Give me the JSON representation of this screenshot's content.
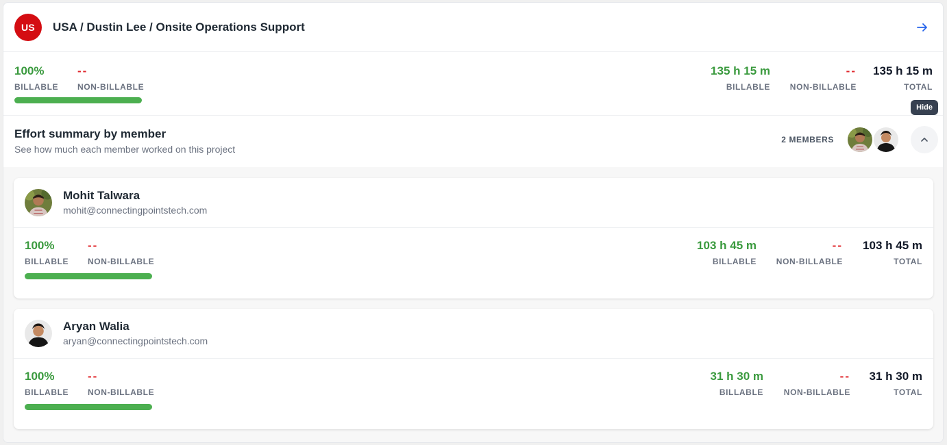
{
  "header": {
    "badge": "US",
    "title": "USA / Dustin Lee / Onsite Operations Support",
    "arrow_icon": "arrow-right-icon"
  },
  "project_stats": {
    "percent": "100%",
    "percent_label": "BILLABLE",
    "non_billable_dash": "--",
    "non_billable_label": "NON-BILLABLE",
    "billable_time": "135 h 15 m",
    "billable_time_label": "BILLABLE",
    "non_billable_time": "--",
    "non_billable_time_label": "NON-BILLABLE",
    "total_time": "135 h 15 m",
    "total_label": "TOTAL",
    "billable_fraction": 1.0
  },
  "summary": {
    "title": "Effort summary by member",
    "subtitle": "See how much each member worked on this project",
    "members_count": "2 MEMBERS",
    "tooltip": "Hide",
    "toggle_icon": "chevron-up-icon"
  },
  "members": [
    {
      "name": "Mohit Talwara",
      "email": "mohit@connectingpointstech.com",
      "percent": "100%",
      "percent_label": "BILLABLE",
      "non_billable_dash": "--",
      "non_billable_label": "NON-BILLABLE",
      "billable_time": "103 h 45 m",
      "billable_time_label": "BILLABLE",
      "non_billable_time": "--",
      "non_billable_time_label": "NON-BILLABLE",
      "total_time": "103 h 45 m",
      "total_label": "TOTAL",
      "billable_fraction": 1.0
    },
    {
      "name": "Aryan Walia",
      "email": "aryan@connectingpointstech.com",
      "percent": "100%",
      "percent_label": "BILLABLE",
      "non_billable_dash": "--",
      "non_billable_label": "NON-BILLABLE",
      "billable_time": "31 h 30 m",
      "billable_time_label": "BILLABLE",
      "non_billable_time": "--",
      "non_billable_time_label": "NON-BILLABLE",
      "total_time": "31 h 30 m",
      "total_label": "TOTAL",
      "billable_fraction": 1.0
    }
  ],
  "colors": {
    "brand_red": "#d40d12",
    "billable_green": "#3a9a3e",
    "bar_green": "#4caf50",
    "non_billable_red": "#e0282e",
    "link_blue": "#2563eb"
  }
}
